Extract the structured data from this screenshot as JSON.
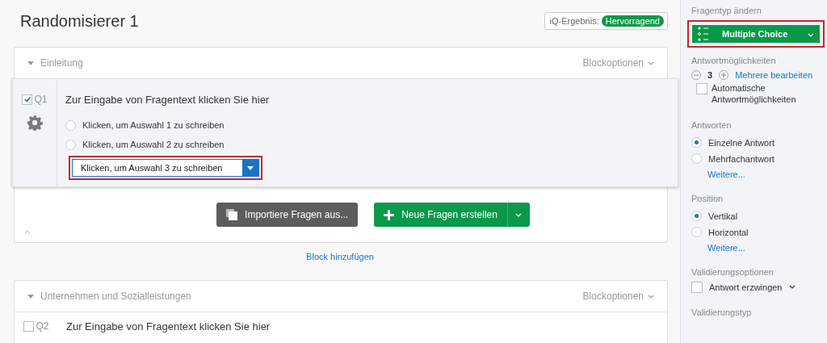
{
  "title": "Randomisierer 1",
  "iq_score": {
    "label": "iQ-Ergebnis:",
    "badge": "Hervorragend"
  },
  "blocks": [
    {
      "name": "Einleitung",
      "options": "Blockoptionen",
      "questions": [
        {
          "number": "Q1",
          "checked": true,
          "selected": true,
          "text": "Zur Eingabe von Fragentext klicken Sie hier",
          "choices": [
            {
              "text": "Klicken, um Auswahl 1 zu schreiben",
              "editing": false,
              "highlighted": false
            },
            {
              "text": "Klicken, um Auswahl 2 zu schreiben",
              "editing": false,
              "highlighted": false
            },
            {
              "text": "Klicken, um Auswahl 3 zu schreiben",
              "editing": true,
              "highlighted": true
            }
          ]
        }
      ],
      "import_button": "Importiere Fragen aus...",
      "new_button": "Neue Fragen erstellen"
    },
    {
      "name": "Unternehmen und Sozialleistungen",
      "options": "Blockoptionen",
      "questions": [
        {
          "number": "Q2",
          "checked": false,
          "selected": false,
          "text": "Zur Eingabe von Fragentext klicken Sie hier"
        }
      ]
    }
  ],
  "add_block": "Block hinzufügen",
  "sidebar": {
    "question_type": {
      "heading": "Fragentyp ändern",
      "value": "Multiple Choice",
      "highlighted": true
    },
    "answer_choices": {
      "heading": "Antwortmöglichkeiten",
      "count": "3",
      "edit_link": "Mehrere bearbeiten",
      "auto": {
        "label": "Automatische Antwortmöglichkeiten",
        "checked": false
      }
    },
    "answers": {
      "heading": "Antworten",
      "options": [
        {
          "label": "Einzelne Antwort",
          "selected": true
        },
        {
          "label": "Mehrfachantwort",
          "selected": false
        }
      ],
      "more": "Weitere..."
    },
    "position": {
      "heading": "Position",
      "options": [
        {
          "label": "Vertikal",
          "selected": true
        },
        {
          "label": "Horizontal",
          "selected": false
        }
      ],
      "more": "Weitere..."
    },
    "validation_options": {
      "heading": "Validierungsoptionen",
      "force": {
        "label": "Antwort erzwingen",
        "checked": false
      }
    },
    "validation_type": {
      "heading": "Validierungstyp"
    }
  }
}
